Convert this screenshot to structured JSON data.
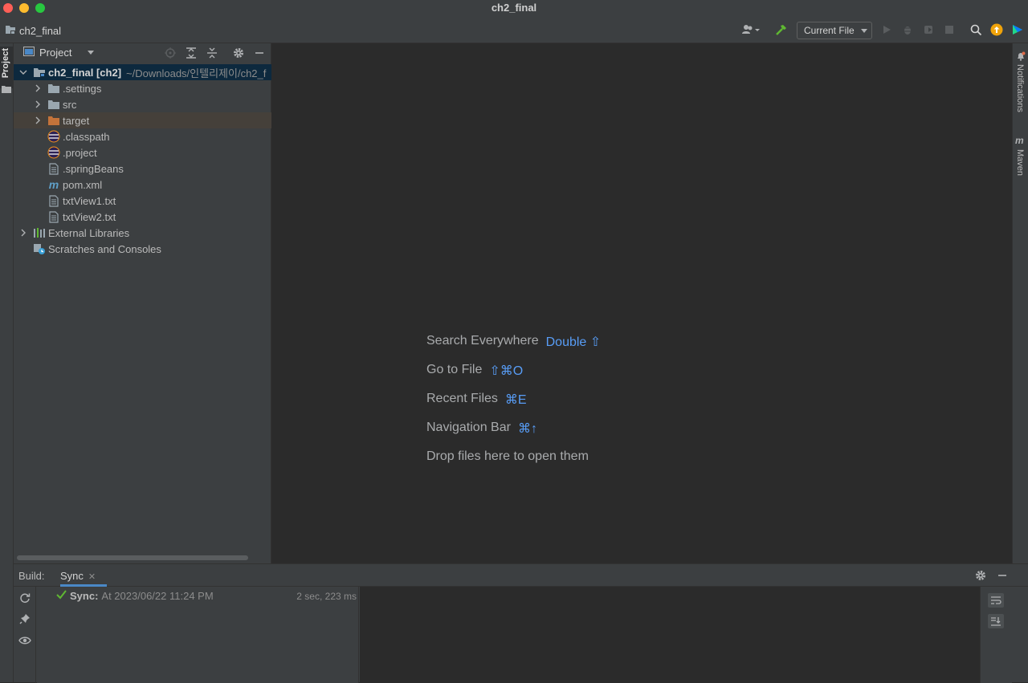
{
  "window": {
    "title": "ch2_final"
  },
  "toolbar": {
    "project_name": "ch2_final",
    "run_config": "Current File"
  },
  "left_stripe": {
    "project_label": "Project"
  },
  "right_stripe": {
    "notifications_label": "Notifications",
    "maven_label": "Maven"
  },
  "project_panel": {
    "title": "Project",
    "root": {
      "name": "ch2_final [ch2]",
      "path": "~/Downloads/인텔리제이/ch2_f"
    },
    "items": [
      {
        "label": ".settings",
        "icon": "folder-icon"
      },
      {
        "label": "src",
        "icon": "folder-icon"
      },
      {
        "label": "target",
        "icon": "folder-orange-icon"
      },
      {
        "label": ".classpath",
        "icon": "eclipse-file-icon"
      },
      {
        "label": ".project",
        "icon": "eclipse-file-icon"
      },
      {
        "label": ".springBeans",
        "icon": "text-file-icon"
      },
      {
        "label": "pom.xml",
        "icon": "maven-icon"
      },
      {
        "label": "txtView1.txt",
        "icon": "text-file-icon"
      },
      {
        "label": "txtView2.txt",
        "icon": "text-file-icon"
      }
    ],
    "external_libraries": "External Libraries",
    "scratches": "Scratches and Consoles"
  },
  "editor_hints": [
    {
      "label": "Search Everywhere",
      "shortcut": "Double ⇧"
    },
    {
      "label": "Go to File",
      "shortcut": "⇧⌘O"
    },
    {
      "label": "Recent Files",
      "shortcut": "⌘E"
    },
    {
      "label": "Navigation Bar",
      "shortcut": "⌘↑"
    },
    {
      "label": "Drop files here to open them",
      "shortcut": ""
    }
  ],
  "build": {
    "label": "Build:",
    "tab": "Sync",
    "sync_title": "Sync:",
    "sync_text": "At 2023/06/22 11:24 PM",
    "sync_duration": "2 sec, 223 ms"
  },
  "colors": {
    "accent_blue": "#589df6",
    "success_green": "#5fb832",
    "folder_gray": "#9aa7b0",
    "folder_orange": "#c4733a"
  }
}
